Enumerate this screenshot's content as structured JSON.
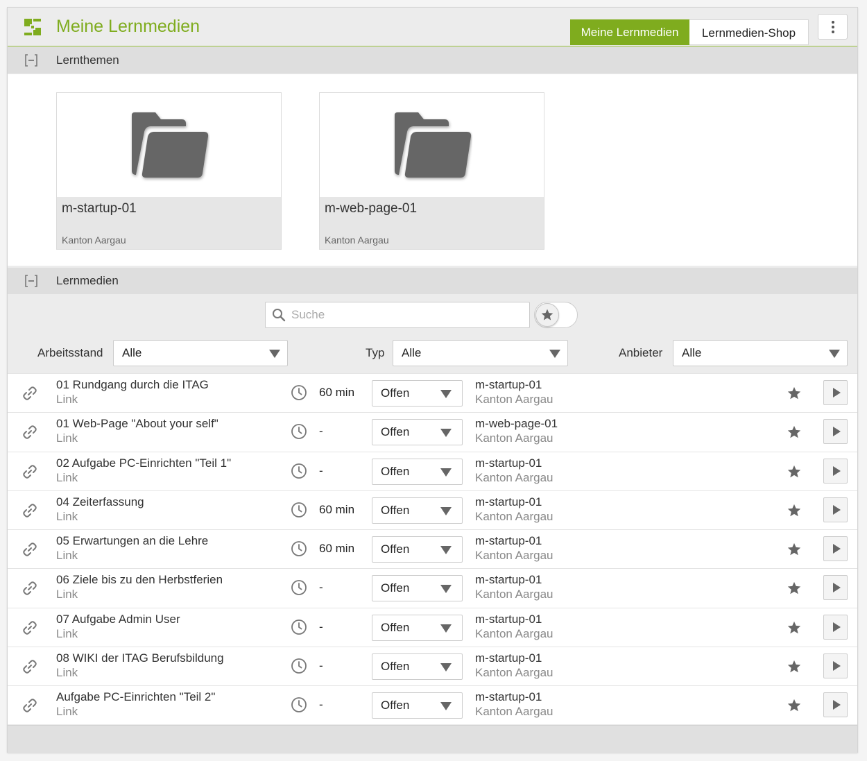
{
  "header": {
    "title": "Meine Lernmedien",
    "tabs": [
      {
        "label": "Meine Lernmedien",
        "active": true
      },
      {
        "label": "Lernmedien-Shop",
        "active": false
      }
    ],
    "more_icon": "kebab-menu-icon",
    "accent_color": "#7fac1e"
  },
  "themes_section": {
    "title": "Lernthemen",
    "cards": [
      {
        "title": "m-startup-01",
        "provider": "Kanton Aargau",
        "icon": "folder-icon"
      },
      {
        "title": "m-web-page-01",
        "provider": "Kanton Aargau",
        "icon": "folder-icon"
      }
    ]
  },
  "media_section": {
    "title": "Lernmedien",
    "search": {
      "placeholder": "Suche",
      "value": ""
    },
    "favorites_toggle": {
      "on": false,
      "icon": "star-icon"
    },
    "filters": {
      "arbeitsstand": {
        "label": "Arbeitsstand",
        "value": "Alle"
      },
      "typ": {
        "label": "Typ",
        "value": "Alle"
      },
      "anbieter": {
        "label": "Anbieter",
        "value": "Alle"
      }
    },
    "items": [
      {
        "title": "01 Rundgang durch die ITAG",
        "type": "Link",
        "duration": "60 min",
        "status": "Offen",
        "theme": "m-startup-01",
        "provider": "Kanton Aargau"
      },
      {
        "title": "01 Web-Page \"About your self\"",
        "type": "Link",
        "duration": "-",
        "status": "Offen",
        "theme": "m-web-page-01",
        "provider": "Kanton Aargau"
      },
      {
        "title": "02 Aufgabe PC-Einrichten \"Teil 1\"",
        "type": "Link",
        "duration": "-",
        "status": "Offen",
        "theme": "m-startup-01",
        "provider": "Kanton Aargau"
      },
      {
        "title": "04 Zeiterfassung",
        "type": "Link",
        "duration": "60 min",
        "status": "Offen",
        "theme": "m-startup-01",
        "provider": "Kanton Aargau"
      },
      {
        "title": "05 Erwartungen an die Lehre",
        "type": "Link",
        "duration": "60 min",
        "status": "Offen",
        "theme": "m-startup-01",
        "provider": "Kanton Aargau"
      },
      {
        "title": "06 Ziele bis zu den Herbstferien",
        "type": "Link",
        "duration": "-",
        "status": "Offen",
        "theme": "m-startup-01",
        "provider": "Kanton Aargau"
      },
      {
        "title": "07 Aufgabe Admin User",
        "type": "Link",
        "duration": "-",
        "status": "Offen",
        "theme": "m-startup-01",
        "provider": "Kanton Aargau"
      },
      {
        "title": "08 WIKI der ITAG Berufsbildung",
        "type": "Link",
        "duration": "-",
        "status": "Offen",
        "theme": "m-startup-01",
        "provider": "Kanton Aargau"
      },
      {
        "title": "Aufgabe PC-Einrichten \"Teil 2\"",
        "type": "Link",
        "duration": "-",
        "status": "Offen",
        "theme": "m-startup-01",
        "provider": "Kanton Aargau"
      }
    ]
  }
}
